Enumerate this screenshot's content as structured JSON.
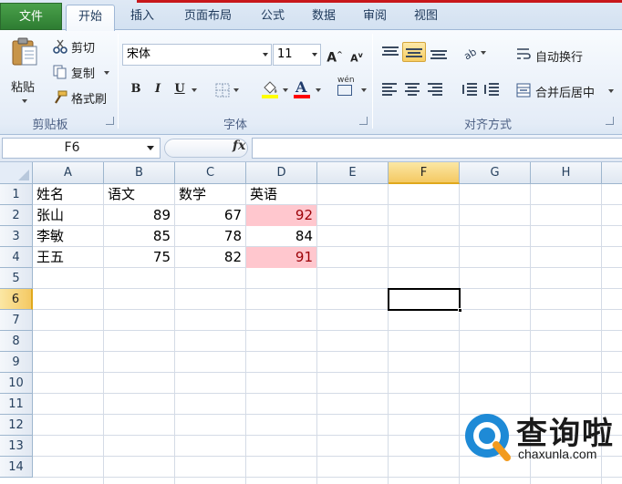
{
  "tabs": {
    "file": "文件",
    "home": "开始",
    "insert": "插入",
    "page_layout": "页面布局",
    "formulas": "公式",
    "data": "数据",
    "review": "审阅",
    "view": "视图"
  },
  "ribbon": {
    "clipboard": {
      "paste": "粘贴",
      "cut": "剪切",
      "copy": "复制",
      "format_painter": "格式刷",
      "label": "剪贴板"
    },
    "font": {
      "name": "宋体",
      "size": "11",
      "grow": "A",
      "shrink": "A",
      "bold": "B",
      "italic": "I",
      "underline": "U",
      "font_color_glyph": "A",
      "phonetic_glyph": "wén",
      "label": "字体",
      "fill_color": "#ffff00",
      "font_color": "#ff0000"
    },
    "alignment": {
      "wrap_text": "自动换行",
      "merge_center": "合并后居中",
      "label": "对齐方式"
    }
  },
  "formula_bar": {
    "name_box": "F6",
    "fx_label": "fx",
    "formula": ""
  },
  "sheet": {
    "columns": [
      "A",
      "B",
      "C",
      "D",
      "E",
      "F",
      "G",
      "H"
    ],
    "rows": [
      "1",
      "2",
      "3",
      "4",
      "5",
      "6",
      "7",
      "8",
      "9",
      "10",
      "11",
      "12",
      "13",
      "14"
    ],
    "selected_cell": "F6",
    "header_row": [
      "姓名",
      "语文",
      "数学",
      "英语"
    ],
    "data_rows": [
      {
        "name": "张山",
        "chinese": "89",
        "math": "67",
        "english": "92",
        "english_highlight": true
      },
      {
        "name": "李敏",
        "chinese": "85",
        "math": "78",
        "english": "84",
        "english_highlight": false
      },
      {
        "name": "王五",
        "chinese": "75",
        "math": "82",
        "english": "91",
        "english_highlight": true
      }
    ],
    "highlight_fill": "#ffc7ce",
    "highlight_text": "#9c0006"
  },
  "watermark": {
    "brand": "查询啦",
    "domain": "chaxunla.com"
  }
}
